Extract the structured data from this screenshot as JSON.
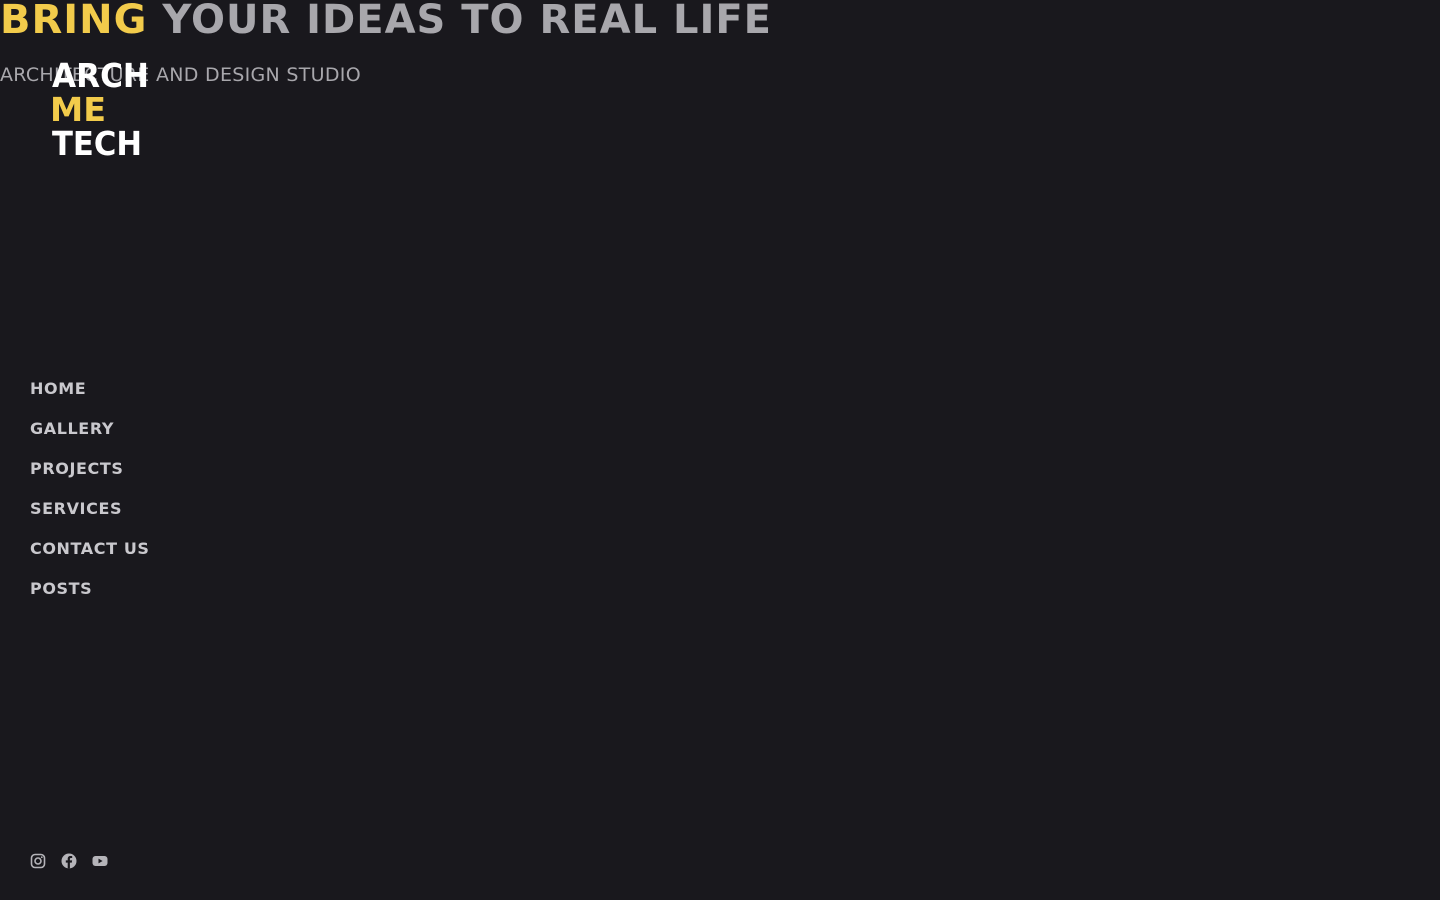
{
  "hero": {
    "title_accent": "BRING",
    "title_rest": "YOUR IDEAS TO REAL LIFE",
    "subtitle": "ARCHITECTURE AND DESIGN STUDIO"
  },
  "logo": {
    "line1": "ARCH",
    "line2": "ME",
    "line3": "TECH",
    "colors": {
      "primary": "#ffffff",
      "accent": "#f2cb4b"
    }
  },
  "nav": {
    "items": [
      {
        "label": "HOME"
      },
      {
        "label": "GALLERY"
      },
      {
        "label": "PROJECTS"
      },
      {
        "label": "SERVICES"
      },
      {
        "label": "CONTACT US"
      },
      {
        "label": "POSTS"
      }
    ]
  },
  "social": {
    "icons": [
      "instagram-icon",
      "facebook-icon",
      "youtube-icon"
    ]
  },
  "colors": {
    "background": "#19181d",
    "accent": "#f2cb4b",
    "text_muted": "#a8a7ac",
    "nav_text": "#c9c8cd"
  }
}
